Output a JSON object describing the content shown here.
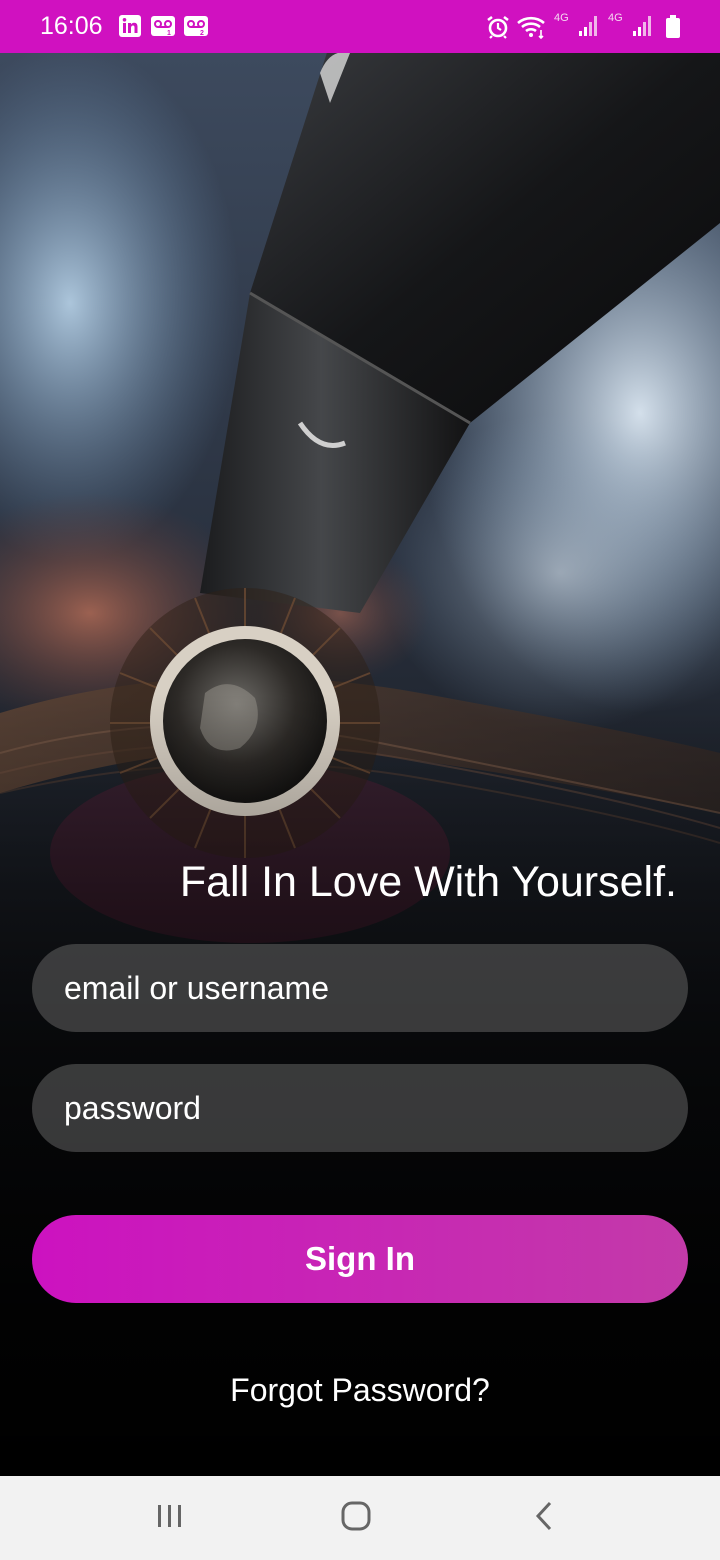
{
  "status_bar": {
    "time": "16:06",
    "network_label_1": "4G",
    "network_label_2": "4G",
    "icons": [
      "linkedin-icon",
      "voicemail-1-icon",
      "voicemail-2-icon",
      "alarm-icon",
      "wifi-icon",
      "signal-1-icon",
      "signal-2-icon",
      "battery-icon"
    ]
  },
  "hero": {
    "tagline": "Fall In Love With Yourself."
  },
  "login_form": {
    "email_placeholder": "email or username",
    "password_placeholder": "password",
    "signin_label": "Sign In",
    "forgot_label": "Forgot Password?"
  },
  "nav_bar": {
    "icons": [
      "recents-icon",
      "home-icon",
      "back-icon"
    ]
  },
  "colors": {
    "status_bar": "#d011c0",
    "accent_start": "#cc12c0",
    "accent_end": "#c33aa9",
    "nav_bar": "#f2f2f2"
  }
}
